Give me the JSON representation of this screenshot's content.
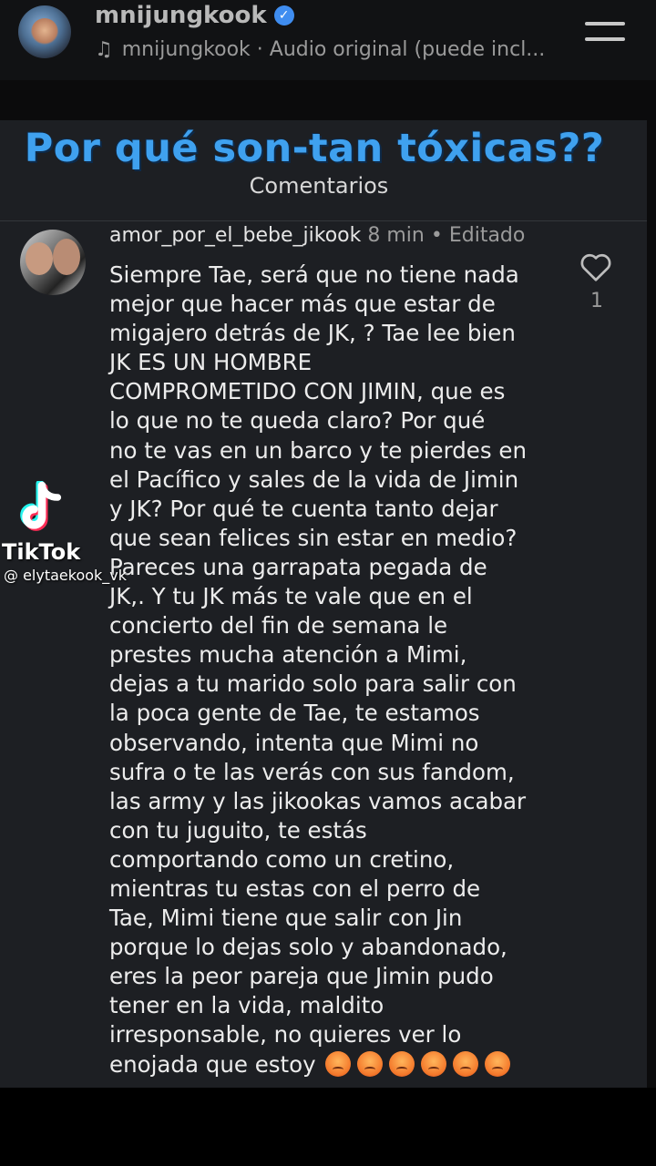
{
  "header": {
    "username": "mnijungkook",
    "audio_text": "mnijungkook · Audio original (puede incl..."
  },
  "overlay": {
    "headline": "Por qué son-tan tóxicas??"
  },
  "comments_section": {
    "title": "Comentarios"
  },
  "comment": {
    "username": "amor_por_el_bebe_jikook",
    "time": "8 min",
    "edited": "Editado",
    "likes": "1",
    "lines": [
      "Siempre Tae, será que no tiene nada",
      "mejor que hacer más que estar de",
      "migajero detrás de JK, ? Tae lee bien",
      "JK ES UN HOMBRE",
      "COMPROMETIDO CON JIMIN, que es",
      "lo  que no te queda claro? Por qué",
      "no te vas en un barco y te pierdes en",
      "el Pacífico y sales de la vida de Jimin",
      "y JK? Por qué te cuenta tanto dejar",
      "que sean felices sin estar en medio?",
      "Pareces una garrapata pegada de",
      "JK,. Y tu JK más te vale que en el",
      "concierto del fin de semana le",
      "prestes mucha atención a Mimi,",
      "dejas a tu marido solo para salir con",
      "la poca gente de Tae, te estamos",
      "observando, intenta que Mimi no",
      "sufra o te las verás con sus fandom,",
      "las army y las jikookas vamos acabar",
      "con tu juguito, te estás",
      "comportando como un cretino,",
      "mientras tu estas con el perro de",
      "Tae,  Mimi tiene que salir con Jin",
      "porque lo dejas solo y abandonado,",
      "eres la peor pareja que Jimin pudo",
      "tener en la vida, maldito",
      "irresponsable, no quieres ver lo",
      "enojada que estoy"
    ]
  },
  "watermark": {
    "brand": "TikTok",
    "handle": "@ elytaekook_vk"
  }
}
